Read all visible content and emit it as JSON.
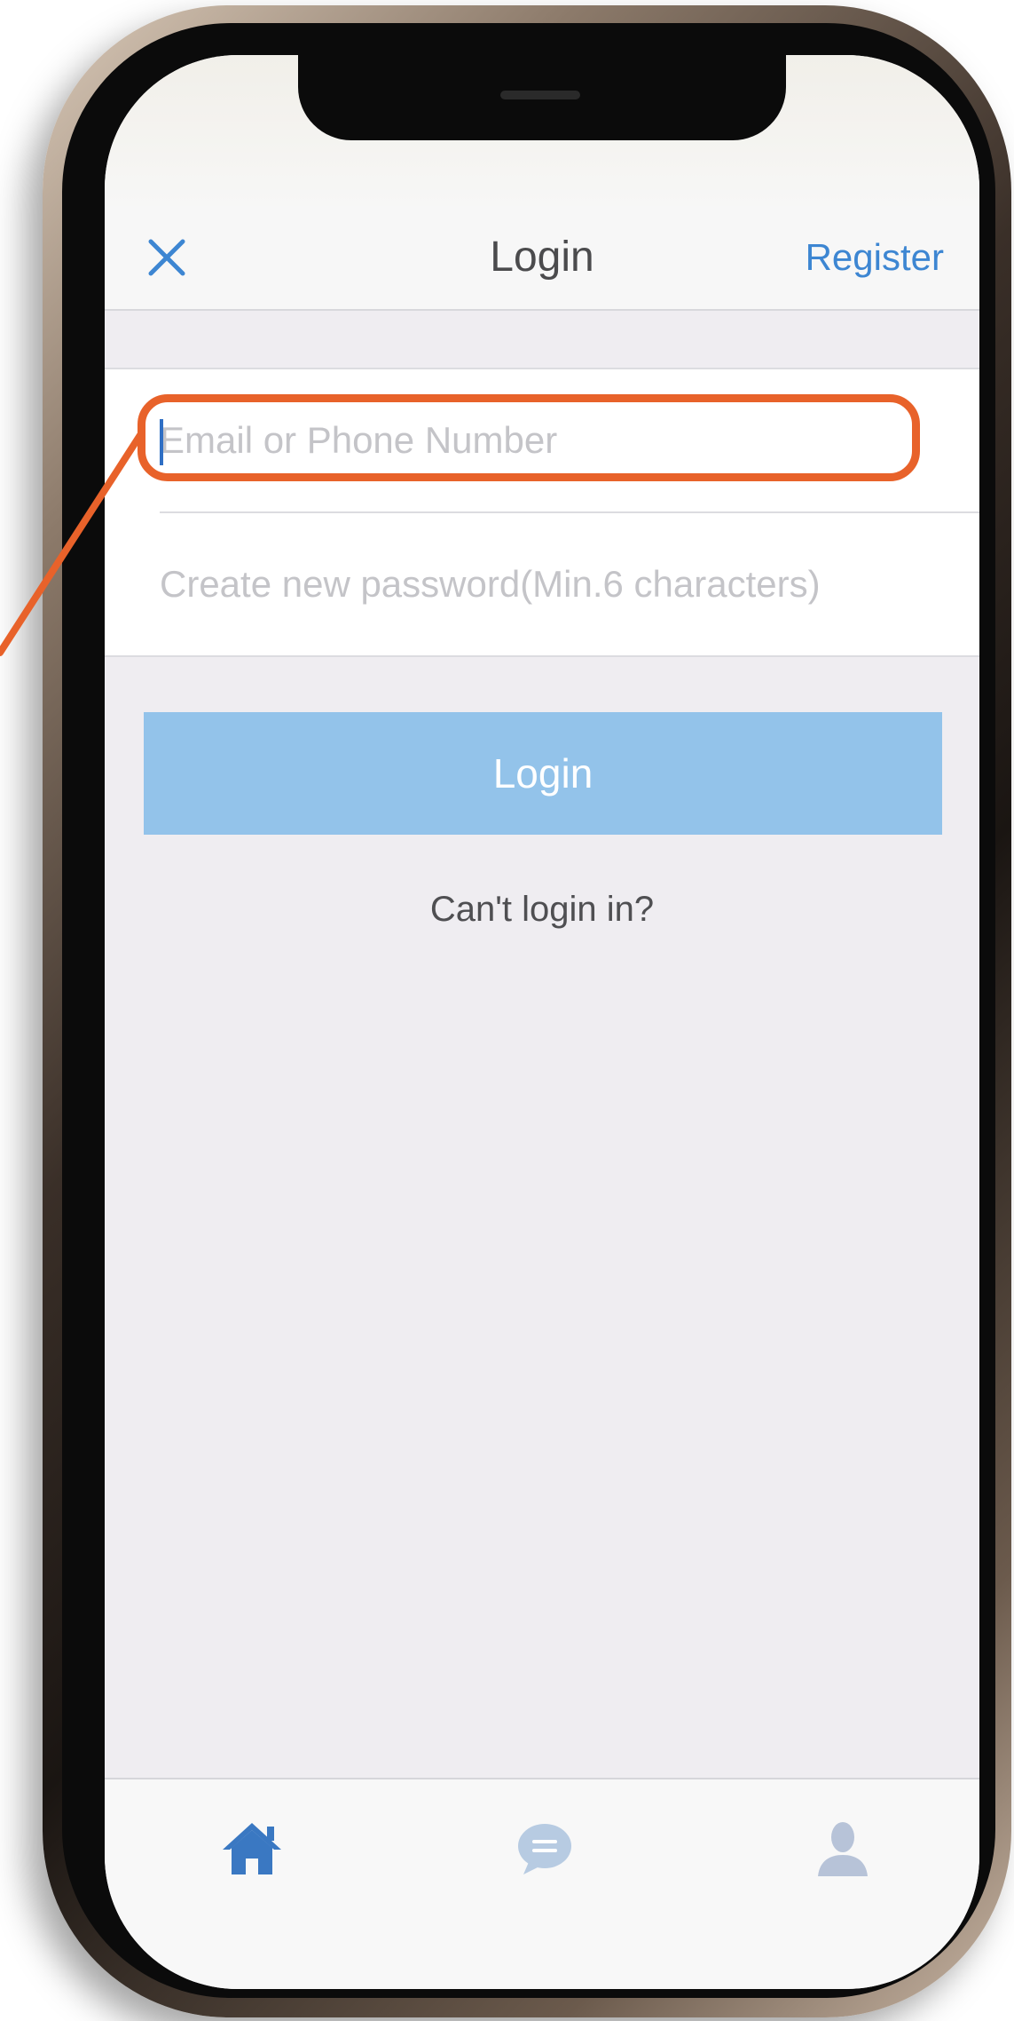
{
  "header": {
    "title": "Login",
    "register_label": "Register",
    "close_icon": "close-icon"
  },
  "form": {
    "email_placeholder": "Email or Phone Number",
    "email_value": "",
    "password_placeholder": "Create new password(Min.6 characters)",
    "password_value": ""
  },
  "actions": {
    "login_label": "Login",
    "cant_login_label": "Can't login in?"
  },
  "tabbar": {
    "items": [
      {
        "icon": "home-icon",
        "active": true
      },
      {
        "icon": "chat-bubble-icon",
        "active": false
      },
      {
        "icon": "user-icon",
        "active": false
      }
    ]
  },
  "colors": {
    "accent": "#3d86d2",
    "login_button": "#93c3ea",
    "highlight": "#e8622a",
    "background": "#efedf1"
  }
}
